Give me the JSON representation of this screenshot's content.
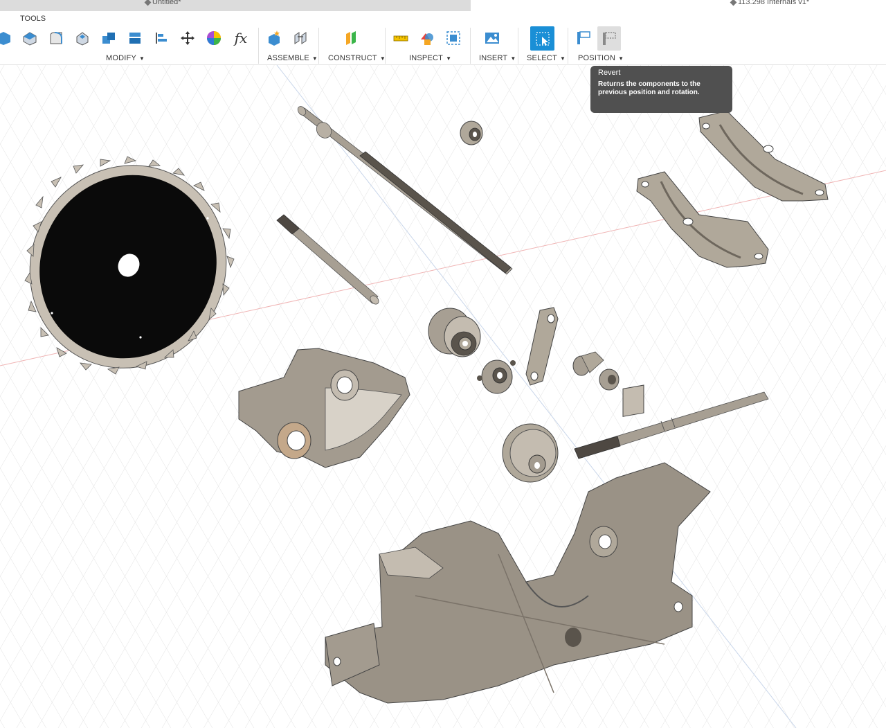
{
  "tabs": {
    "active_tab": "Untitled*",
    "other_tab": "113.298 Internals v1*"
  },
  "toolbar": {
    "tools_label": "TOOLS",
    "groups": {
      "modify": "MODIFY",
      "assemble": "ASSEMBLE",
      "construct": "CONSTRUCT",
      "inspect": "INSPECT",
      "insert": "INSERT",
      "select": "SELECT",
      "position": "POSITION"
    },
    "fx_glyph": "fx"
  },
  "tooltip": {
    "title": "Revert",
    "body": "Returns the components to the previous position and rotation."
  },
  "colors": {
    "select_active": "#1a8fd6",
    "part_tan": "#b0a89a",
    "part_dark": "#8e867a",
    "blade": "#0a0a0a",
    "grid": "#e3e3e3"
  }
}
